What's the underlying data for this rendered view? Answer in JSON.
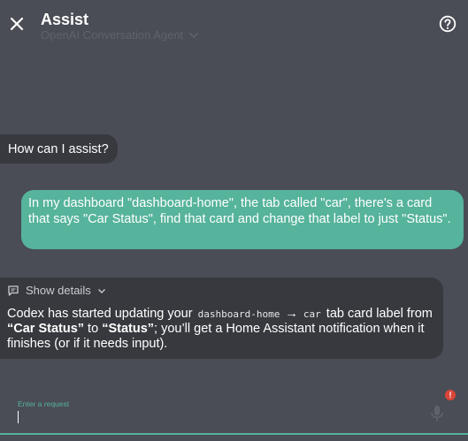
{
  "header": {
    "title": "Assist",
    "agent": "OpenAI Conversation Agent"
  },
  "messages": {
    "greeting": "How can I assist?",
    "user": "In my dashboard \"dashboard-home\", the tab called \"car\", there's a card that says \"Car Status\", find that card and change that label to just \"Status\".",
    "reply": {
      "details_label": "Show details",
      "part1": "Codex has started updating your ",
      "code1": "dashboard-home",
      "arrow": "→",
      "code2": "car",
      "part2": " tab card label from ",
      "from_label": "“Car Status”",
      "to_word": " to ",
      "to_label": "“Status”",
      "part3": "; you’ll get a Home Assistant notification when it finishes (or if it needs input)."
    }
  },
  "input": {
    "label": "Enter a request",
    "value": "",
    "alert_badge": "!"
  },
  "colors": {
    "background": "#4a4d55",
    "accent": "#56b39c",
    "bubble": "#37393f",
    "alert": "#db4437"
  },
  "icons": [
    "close-icon",
    "chevron-down-icon",
    "help-icon",
    "comment-icon",
    "microphone-icon"
  ]
}
